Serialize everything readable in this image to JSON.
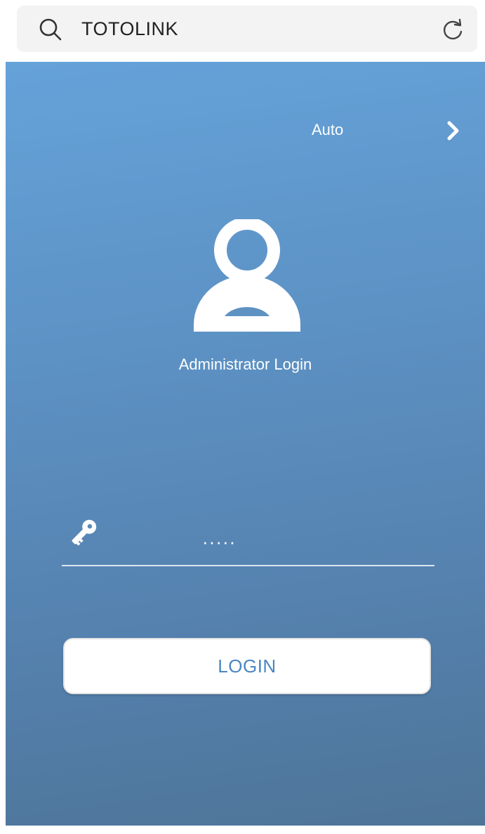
{
  "browser": {
    "address_text": "TOTOLINK",
    "search_icon": "search-icon",
    "reload_icon": "reload-icon"
  },
  "header": {
    "language_label": "Auto",
    "language_chevron": "chevron-right-icon"
  },
  "login": {
    "title": "Administrator Login",
    "password_value": "·····",
    "button_label": "LOGIN"
  },
  "colors": {
    "panel_top": "#65a2d9",
    "panel_bottom": "#4e7598",
    "button_text": "#4a86c3"
  }
}
